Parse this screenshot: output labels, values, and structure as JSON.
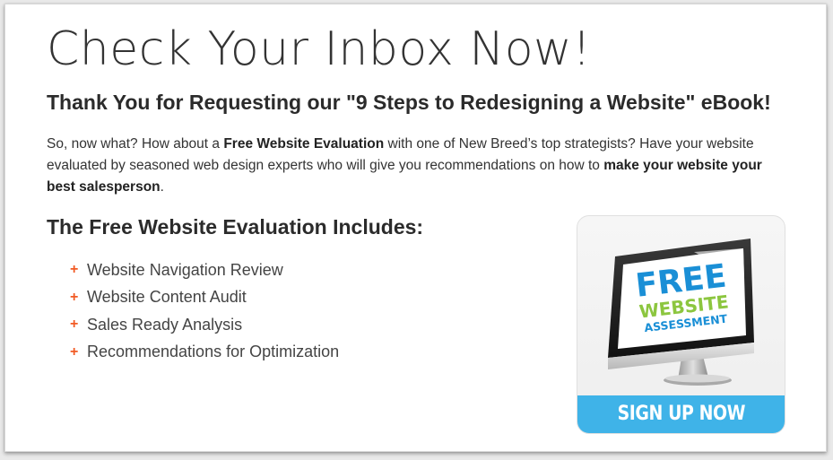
{
  "headline": "Check Your Inbox Now!",
  "subheadline": "Thank You for Requesting our \"9 Steps to Redesigning a Website\" eBook!",
  "intro": {
    "part1": "So, now what? How about a ",
    "bold1": "Free Website Evaluation",
    "part2": " with one of New Breed’s top strategists? Have your website evaluated by seasoned web design experts who will give you recommendations on how to ",
    "bold2": "make your website your best salesperson",
    "part3": "."
  },
  "includes_title": "The Free Website Evaluation Includes:",
  "bullet_symbol": "+",
  "features": [
    "Website Navigation Review",
    "Website Content Audit",
    "Sales Ready Analysis",
    "Recommendations for Optimization"
  ],
  "cta": {
    "screen_line1": "FREE",
    "screen_line2": "WEBSITE",
    "screen_line3": "ASSESSMENT",
    "button_label": "SIGN UP NOW",
    "icon": "monitor-icon"
  },
  "colors": {
    "accent_orange": "#f15a24",
    "cta_blue": "#3fb3e8",
    "free_blue": "#1a8fd6",
    "website_green": "#8cc63f"
  }
}
